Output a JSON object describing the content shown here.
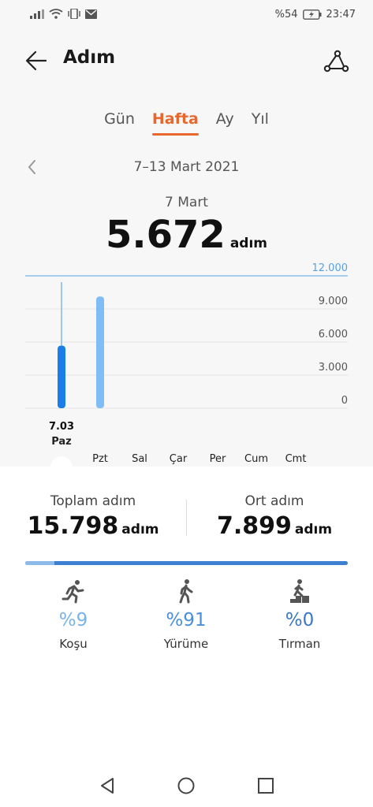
{
  "status_bar": {
    "battery": "%54",
    "time": "23:47"
  },
  "header": {
    "title": "Adım",
    "back_icon": "arrow-left-icon",
    "share_icon": "share-icon"
  },
  "tabs": [
    {
      "label": "Gün",
      "active": false
    },
    {
      "label": "Hafta",
      "active": true
    },
    {
      "label": "Ay",
      "active": false
    },
    {
      "label": "Yıl",
      "active": false
    }
  ],
  "period": {
    "range": "7–13 Mart 2021"
  },
  "selected": {
    "day": "7 Mart",
    "value": "5.672",
    "unit": "adım",
    "tooltip_date": "7.03"
  },
  "chart_data": {
    "type": "bar",
    "categories": [
      "Paz",
      "Pzt",
      "Sal",
      "Çar",
      "Per",
      "Cum",
      "Cmt"
    ],
    "values": [
      5672,
      10126,
      0,
      0,
      0,
      0,
      0
    ],
    "goal_label": "12.000",
    "goal": 12000,
    "yticks": [
      "9.000",
      "6.000",
      "3.000",
      "0"
    ],
    "ytick_values": [
      9000,
      6000,
      3000,
      0
    ],
    "ylim": [
      0,
      12000
    ],
    "selected_index": 0,
    "colors": {
      "selected": "#1a7ee8",
      "other": "#7ebdf5",
      "goal": "#5aa0e0"
    }
  },
  "summary": {
    "total_label": "Toplam adım",
    "total_value": "15.798",
    "avg_label": "Ort adım",
    "avg_value": "7.899",
    "unit": "adım"
  },
  "activity_split": {
    "run_fraction": 0.09
  },
  "categories": [
    {
      "pct": "%9",
      "label": "Koşu",
      "icon": "running-icon",
      "color": "#7ab3e8"
    },
    {
      "pct": "%91",
      "label": "Yürüme",
      "icon": "walking-icon",
      "color": "#4a8fd9"
    },
    {
      "pct": "%0",
      "label": "Tırman",
      "icon": "climbing-icon",
      "color": "#3a78c7"
    }
  ],
  "nav": {
    "back": "triangle-back-icon",
    "home": "circle-home-icon",
    "recents": "square-recents-icon"
  }
}
